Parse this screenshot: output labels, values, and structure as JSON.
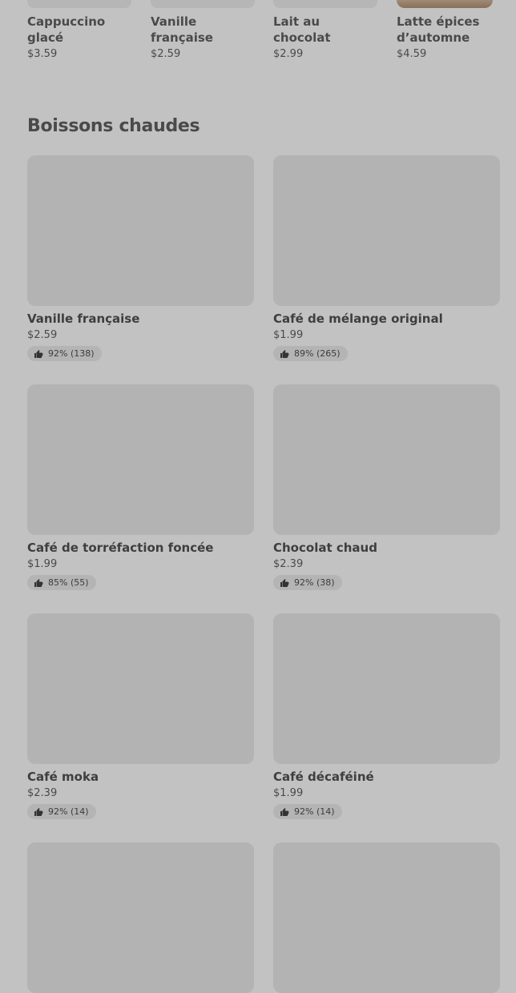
{
  "top_row": [
    {
      "name": "Cappuccino glacé",
      "price": "$3.59"
    },
    {
      "name": "Vanille française",
      "price": "$2.59"
    },
    {
      "name": "Lait au chocolat",
      "price": "$2.99"
    },
    {
      "name": "Latte épices d’automne",
      "price": "$4.59"
    }
  ],
  "section": {
    "title": "Boissons chaudes"
  },
  "products": [
    {
      "name": "Vanille française",
      "price": "$2.59",
      "rating": "92% (138)"
    },
    {
      "name": "Café de mélange original",
      "price": "$1.99",
      "rating": "89% (265)"
    },
    {
      "name": "Café de torréfaction foncée",
      "price": "$1.99",
      "rating": "85% (55)"
    },
    {
      "name": "Chocolat chaud",
      "price": "$2.39",
      "rating": "92% (38)"
    },
    {
      "name": "Café moka",
      "price": "$2.39",
      "rating": "92% (14)"
    },
    {
      "name": "Café décaféiné",
      "price": "$1.99",
      "rating": "92% (14)"
    },
    {
      "name": "",
      "price": "",
      "rating": ""
    },
    {
      "name": "",
      "price": "",
      "rating": ""
    }
  ],
  "icons": {
    "rating": "thumbs-up-icon"
  }
}
